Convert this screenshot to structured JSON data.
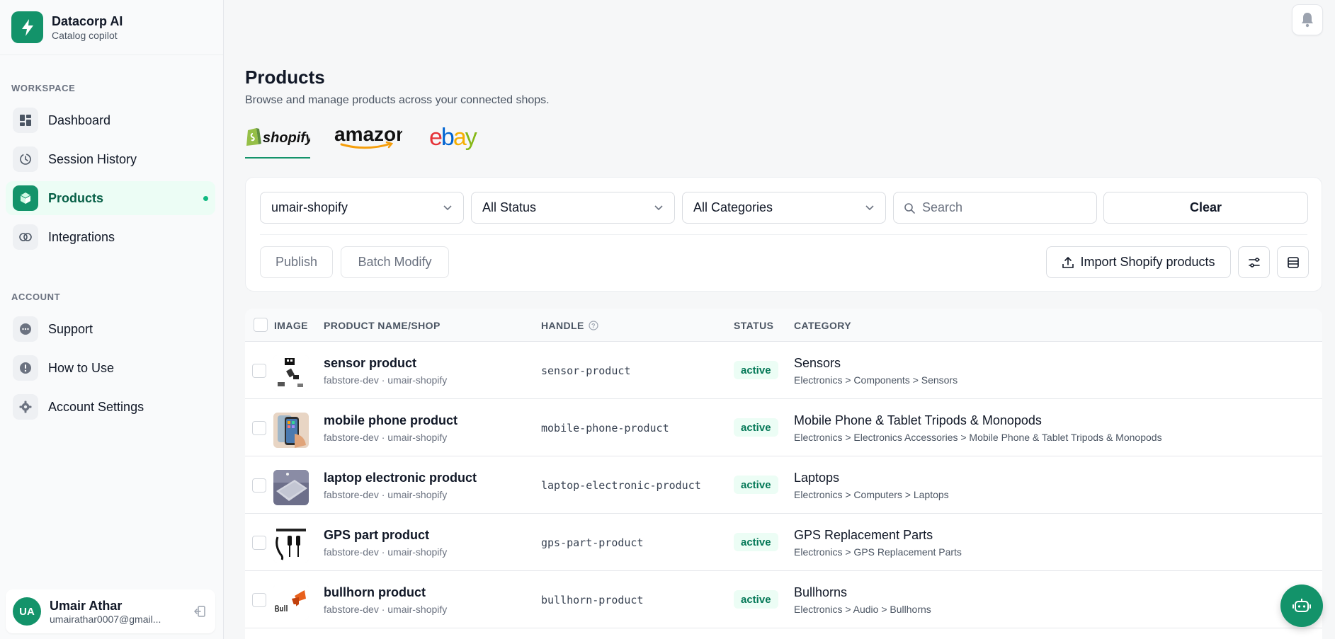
{
  "brand": {
    "name": "Datacorp AI",
    "subtitle": "Catalog copilot"
  },
  "sidebar": {
    "workspace_label": "WORKSPACE",
    "workspace_items": [
      {
        "label": "Dashboard",
        "icon": "grid-icon"
      },
      {
        "label": "Session History",
        "icon": "history-icon"
      },
      {
        "label": "Products",
        "icon": "box-icon",
        "active": true
      },
      {
        "label": "Integrations",
        "icon": "link-icon"
      }
    ],
    "account_label": "ACCOUNT",
    "account_items": [
      {
        "label": "Support",
        "icon": "chat-icon"
      },
      {
        "label": "How to Use",
        "icon": "help-icon"
      },
      {
        "label": "Account Settings",
        "icon": "gear-icon"
      }
    ]
  },
  "user": {
    "initials": "UA",
    "name": "Umair Athar",
    "email": "umairathar0007@gmail..."
  },
  "page": {
    "title": "Products",
    "subtitle": "Browse and manage products across your connected shops.",
    "shop_tabs": [
      "shopify",
      "amazon",
      "ebay"
    ],
    "active_tab": "shopify"
  },
  "filters": {
    "shop": "umair-shopify",
    "status": "All Status",
    "category": "All Categories",
    "search_placeholder": "Search",
    "clear_label": "Clear"
  },
  "actions": {
    "publish": "Publish",
    "batch_modify": "Batch Modify",
    "import": "Import Shopify products"
  },
  "table": {
    "headers": {
      "image": "IMAGE",
      "name": "PRODUCT NAME/SHOP",
      "handle": "HANDLE",
      "status": "STATUS",
      "category": "CATEGORY"
    },
    "rows": [
      {
        "name": "sensor product",
        "shop": "fabstore-dev · umair-shopify",
        "handle": "sensor-product",
        "status": "active",
        "category": "Sensors",
        "category_path": "Electronics > Components > Sensors"
      },
      {
        "name": "mobile phone product",
        "shop": "fabstore-dev · umair-shopify",
        "handle": "mobile-phone-product",
        "status": "active",
        "category": "Mobile Phone & Tablet Tripods & Monopods",
        "category_path": "Electronics > Electronics Accessories > Mobile Phone & Tablet Tripods & Monopods"
      },
      {
        "name": "laptop electronic product",
        "shop": "fabstore-dev · umair-shopify",
        "handle": "laptop-electronic-product",
        "status": "active",
        "category": "Laptops",
        "category_path": "Electronics > Computers > Laptops"
      },
      {
        "name": "GPS part product",
        "shop": "fabstore-dev · umair-shopify",
        "handle": "gps-part-product",
        "status": "active",
        "category": "GPS Replacement Parts",
        "category_path": "Electronics > GPS Replacement Parts"
      },
      {
        "name": "bullhorn product",
        "shop": "fabstore-dev · umair-shopify",
        "handle": "bullhorn-product",
        "status": "active",
        "category": "Bullhorns",
        "category_path": "Electronics > Audio > Bullhorns"
      }
    ]
  },
  "colors": {
    "accent": "#13936a",
    "badge_bg": "#ecfdf5",
    "badge_text": "#047857"
  }
}
